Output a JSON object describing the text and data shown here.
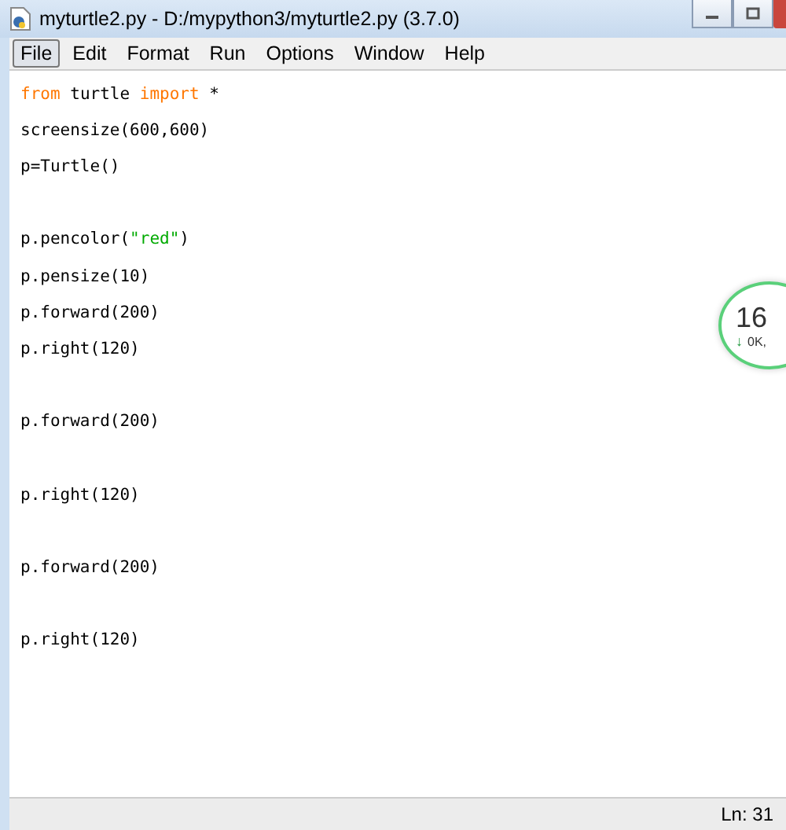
{
  "window": {
    "title": "myturtle2.py - D:/mypython3/myturtle2.py (3.7.0)"
  },
  "menu": [
    {
      "label": "File",
      "selected": true
    },
    {
      "label": "Edit",
      "selected": false
    },
    {
      "label": "Format",
      "selected": false
    },
    {
      "label": "Run",
      "selected": false
    },
    {
      "label": "Options",
      "selected": false
    },
    {
      "label": "Window",
      "selected": false
    },
    {
      "label": "Help",
      "selected": false
    }
  ],
  "code_lines": [
    {
      "kind": "code",
      "tokens": [
        {
          "kind": "keyword",
          "text": "from"
        },
        {
          "kind": "plain",
          "text": " turtle "
        },
        {
          "kind": "keyword",
          "text": "import"
        },
        {
          "kind": "plain",
          "text": " *"
        }
      ]
    },
    {
      "kind": "code",
      "tokens": [
        {
          "kind": "plain",
          "text": "screensize(600,600)"
        }
      ]
    },
    {
      "kind": "code",
      "tokens": [
        {
          "kind": "plain",
          "text": "p=Turtle()"
        }
      ]
    },
    {
      "kind": "blank"
    },
    {
      "kind": "code",
      "tokens": [
        {
          "kind": "plain",
          "text": "p.pencolor("
        },
        {
          "kind": "string",
          "text": "\"red\""
        },
        {
          "kind": "plain",
          "text": ")"
        }
      ]
    },
    {
      "kind": "code",
      "tokens": [
        {
          "kind": "plain",
          "text": "p.pensize(10)"
        }
      ]
    },
    {
      "kind": "code",
      "tokens": [
        {
          "kind": "plain",
          "text": "p.forward(200)"
        }
      ]
    },
    {
      "kind": "code",
      "tokens": [
        {
          "kind": "plain",
          "text": "p.right(120)"
        }
      ]
    },
    {
      "kind": "blank"
    },
    {
      "kind": "code",
      "tokens": [
        {
          "kind": "plain",
          "text": "p.forward(200)"
        }
      ]
    },
    {
      "kind": "blank"
    },
    {
      "kind": "code",
      "tokens": [
        {
          "kind": "plain",
          "text": "p.right(120)"
        }
      ]
    },
    {
      "kind": "blank"
    },
    {
      "kind": "code",
      "tokens": [
        {
          "kind": "plain",
          "text": "p.forward(200)"
        }
      ]
    },
    {
      "kind": "blank"
    },
    {
      "kind": "code",
      "tokens": [
        {
          "kind": "plain",
          "text": "p.right(120)"
        }
      ]
    }
  ],
  "speed_widget": {
    "value": "16",
    "rate": "0K,",
    "arrow": "↓"
  },
  "status_bar": {
    "position": "Ln: 31"
  }
}
